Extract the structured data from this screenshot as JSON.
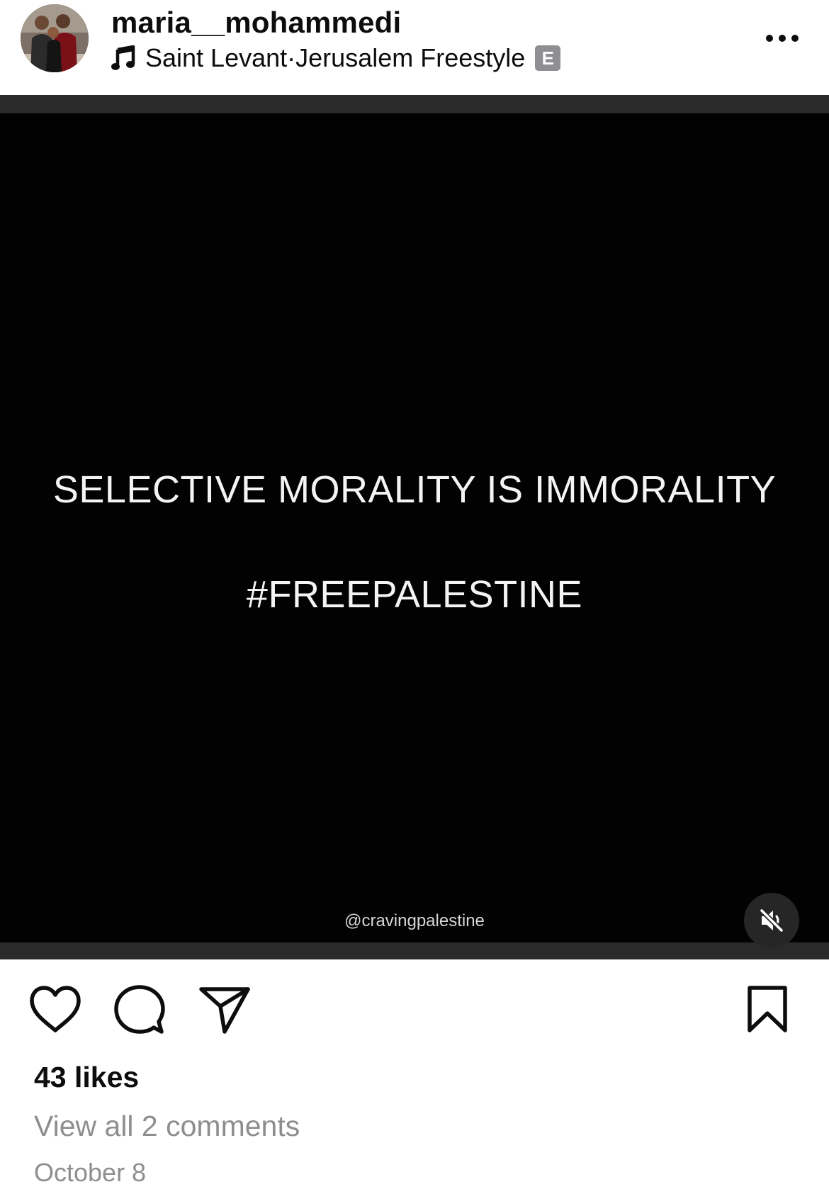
{
  "header": {
    "username": "maria__mohammedi",
    "audio": {
      "artist": "Saint Levant",
      "separator": " · ",
      "track": "Jerusalem Freestyle",
      "explicit_badge": "E"
    },
    "icons": {
      "avatar": "profile-photo",
      "music": "music-note-icon",
      "more": "more-options-icon"
    }
  },
  "media": {
    "line_1": "SELECTIVE MORALITY IS IMMORALITY",
    "line_2": "#FREEPALESTINE",
    "watermark": "@cravingpalestine",
    "audio_state": "muted",
    "icons": {
      "mute": "speaker-muted-icon"
    }
  },
  "actions": {
    "icons": [
      "heart-icon",
      "comment-icon",
      "send-icon",
      "bookmark-icon"
    ]
  },
  "footer": {
    "likes": "43 likes",
    "view_comments": "View all 2 comments",
    "date": "October 8"
  },
  "colors": {
    "background": "#ffffff",
    "media_background": "#020202",
    "primary_text": "#0d0d0d",
    "secondary_text": "#8e8e8e",
    "badge": "#8e8e93"
  }
}
